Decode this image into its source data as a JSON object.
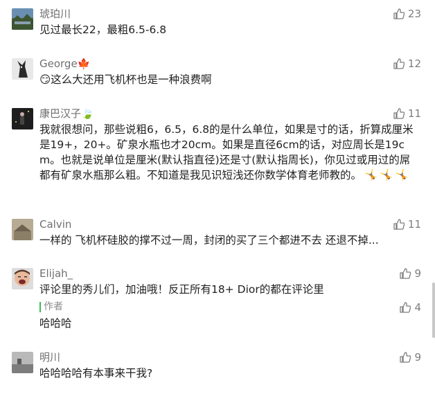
{
  "comments": [
    {
      "nickname": "琥珀川",
      "content": "见过最长22，最粗6.5-6.8",
      "likes": "23",
      "avatar": "landscape-avatar-icon"
    },
    {
      "nickname": "George🍁",
      "content": "😏这么大还用飞机杯也是一种浪费啊",
      "likes": "12",
      "avatar": "bird-avatar-icon"
    },
    {
      "nickname": "康巴汉子🍃",
      "content": "我就很想问，那些说粗6，6.5，6.8的是什么单位，如果是寸的话，折算成厘米是19+，20+。矿泉水瓶也才20cm。如果是直径6cm的话，对应周长是19cm。也就是说单位是厘米(默认指直径)还是寸(默认指周长)，你见过或用过的屌都有矿泉水瓶那么粗。不知道是我见识短浅还你数学体育老师教的。",
      "emoji": "🤸🤸🤸",
      "likes": "11",
      "avatar": "dark-figure-avatar-icon"
    },
    {
      "nickname": "Calvin",
      "content": "一样的 飞机杯硅胶的撑不过一周，封闭的买了三个都进不去 还退不掉...",
      "likes": "11",
      "avatar": "building-avatar-icon"
    },
    {
      "nickname": "Elijah_",
      "content": "评论里的秀儿们，加油哦！反正所有18+ Dior的都在评论里",
      "likes": "9",
      "avatar": "laughing-child-avatar-icon",
      "reply": {
        "label": "作者",
        "text": "哈哈哈",
        "likes": "4"
      }
    },
    {
      "nickname": "明川",
      "content": "哈哈哈哈有本事来干我?",
      "likes": "9",
      "avatar": "grey-landscape-avatar-icon"
    }
  ],
  "colors": {
    "accent": "#3cba5a",
    "like_icon": "#7c7c7c",
    "nickname": "#6f6f6f"
  }
}
